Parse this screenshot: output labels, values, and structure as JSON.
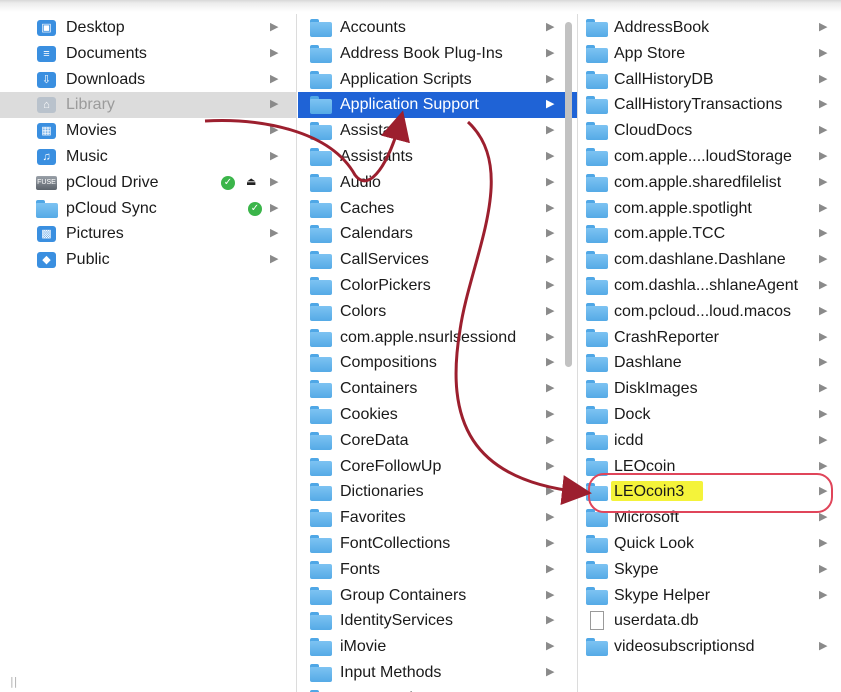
{
  "sidebar": {
    "items": [
      {
        "label": "Desktop",
        "icon": "desktop-icon"
      },
      {
        "label": "Documents",
        "icon": "documents-icon"
      },
      {
        "label": "Downloads",
        "icon": "downloads-icon"
      },
      {
        "label": "Library",
        "icon": "library-icon",
        "state": "dimmed"
      },
      {
        "label": "Movies",
        "icon": "movies-icon"
      },
      {
        "label": "Music",
        "icon": "music-icon"
      },
      {
        "label": "pCloud Drive",
        "icon": "drive-icon",
        "synced": true,
        "ejectable": true
      },
      {
        "label": "pCloud Sync",
        "icon": "folder-icon",
        "synced": true
      },
      {
        "label": "Pictures",
        "icon": "pictures-icon"
      },
      {
        "label": "Public",
        "icon": "public-icon"
      }
    ],
    "drive_badge": "FUSE"
  },
  "library": {
    "items": [
      "Accounts",
      "Address Book Plug-Ins",
      "Application Scripts",
      "Application Support",
      "Assistant",
      "Assistants",
      "Audio",
      "Caches",
      "Calendars",
      "CallServices",
      "ColorPickers",
      "Colors",
      "com.apple.nsurlsessiond",
      "Compositions",
      "Containers",
      "Cookies",
      "CoreData",
      "CoreFollowUp",
      "Dictionaries",
      "Favorites",
      "FontCollections",
      "Fonts",
      "Group Containers",
      "IdentityServices",
      "iMovie",
      "Input Methods",
      "Internet Plug-Ins"
    ],
    "selected": "Application Support"
  },
  "app_support": {
    "items": [
      {
        "label": "AddressBook"
      },
      {
        "label": "App Store"
      },
      {
        "label": "CallHistoryDB"
      },
      {
        "label": "CallHistoryTransactions"
      },
      {
        "label": "CloudDocs"
      },
      {
        "label": "com.apple....loudStorage"
      },
      {
        "label": "com.apple.sharedfilelist"
      },
      {
        "label": "com.apple.spotlight"
      },
      {
        "label": "com.apple.TCC"
      },
      {
        "label": "com.dashlane.Dashlane"
      },
      {
        "label": "com.dashla...shlaneAgent"
      },
      {
        "label": "com.pcloud...loud.macos"
      },
      {
        "label": "CrashReporter"
      },
      {
        "label": "Dashlane"
      },
      {
        "label": "DiskImages"
      },
      {
        "label": "Dock"
      },
      {
        "label": "icdd"
      },
      {
        "label": "LEOcoin"
      },
      {
        "label": "LEOcoin3",
        "highlighted": true
      },
      {
        "label": "Microsoft"
      },
      {
        "label": "Quick Look"
      },
      {
        "label": "Skype"
      },
      {
        "label": "Skype Helper"
      },
      {
        "label": "userdata.db",
        "kind": "file"
      },
      {
        "label": "videosubscriptionsd"
      }
    ]
  },
  "colors": {
    "selection": "#1f63d6",
    "folder": "#6bb8ef",
    "highlight": "#f4f33a",
    "annotation": "#9c1f2e",
    "circle": "#e0455a",
    "sync_check": "#3bb54a"
  }
}
